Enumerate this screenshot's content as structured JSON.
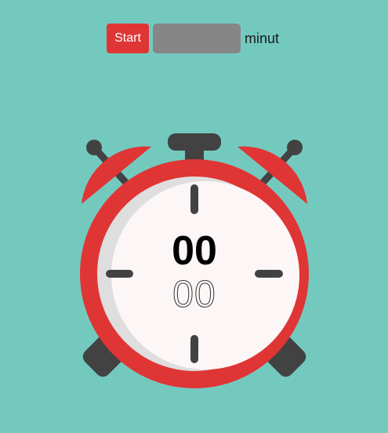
{
  "controls": {
    "start_label": "Start",
    "minutes_value": "",
    "minutes_placeholder": "",
    "unit_label": "minut"
  },
  "timer": {
    "minutes": "00",
    "seconds": "00"
  },
  "colors": {
    "background": "#74c9bf",
    "accent_red": "#e03535",
    "dark_gray": "#424242",
    "face": "#fcf6f6"
  }
}
